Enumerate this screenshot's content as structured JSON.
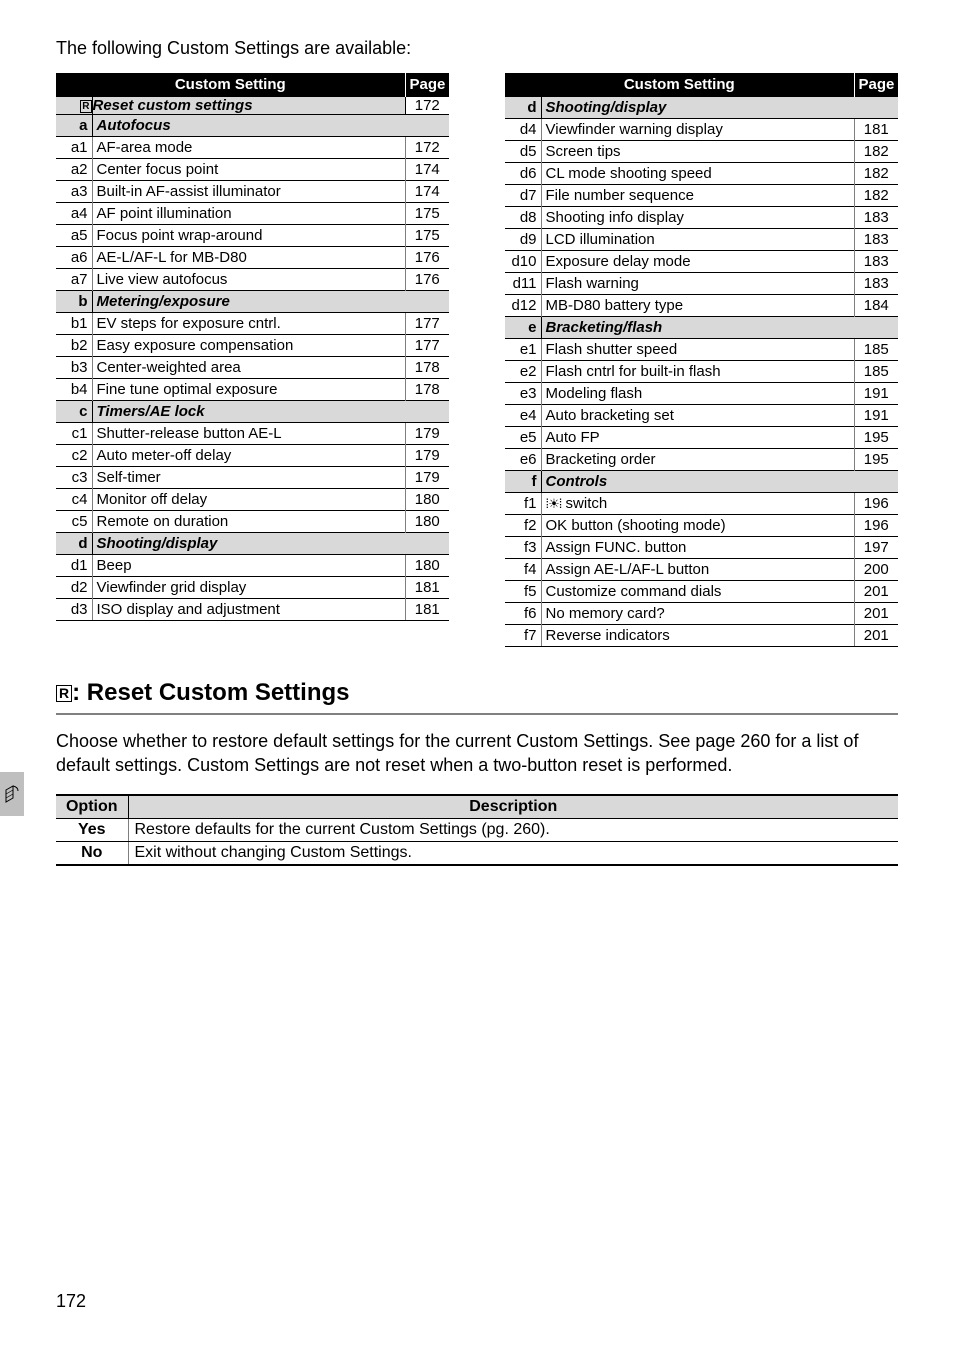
{
  "intro": "The following Custom Settings are available:",
  "table_header": {
    "setting": "Custom Setting",
    "page": "Page"
  },
  "reset_row": {
    "code": "R",
    "label": "Reset custom settings",
    "page": "172"
  },
  "col1": [
    {
      "group": true,
      "code": "a",
      "label": "Autofocus"
    },
    {
      "code": "a1",
      "label": "AF-area mode",
      "page": "172"
    },
    {
      "code": "a2",
      "label": "Center focus point",
      "page": "174"
    },
    {
      "code": "a3",
      "label": "Built-in AF-assist illuminator",
      "page": "174"
    },
    {
      "code": "a4",
      "label": "AF point illumination",
      "page": "175"
    },
    {
      "code": "a5",
      "label": "Focus point wrap-around",
      "page": "175"
    },
    {
      "code": "a6",
      "label": "AE-L/AF-L for MB-D80",
      "page": "176"
    },
    {
      "code": "a7",
      "label": "Live view autofocus",
      "page": "176"
    },
    {
      "group": true,
      "code": "b",
      "label": "Metering/exposure"
    },
    {
      "code": "b1",
      "label": "EV steps for exposure cntrl.",
      "page": "177"
    },
    {
      "code": "b2",
      "label": "Easy exposure compensation",
      "page": "177"
    },
    {
      "code": "b3",
      "label": "Center-weighted area",
      "page": "178"
    },
    {
      "code": "b4",
      "label": "Fine tune optimal exposure",
      "page": "178"
    },
    {
      "group": true,
      "code": "c",
      "label": "Timers/AE lock"
    },
    {
      "code": "c1",
      "label": "Shutter-release button AE-L",
      "page": "179"
    },
    {
      "code": "c2",
      "label": "Auto meter-off delay",
      "page": "179"
    },
    {
      "code": "c3",
      "label": "Self-timer",
      "page": "179"
    },
    {
      "code": "c4",
      "label": "Monitor off delay",
      "page": "180"
    },
    {
      "code": "c5",
      "label": "Remote on duration",
      "page": "180"
    },
    {
      "group": true,
      "code": "d",
      "label": "Shooting/display"
    },
    {
      "code": "d1",
      "label": "Beep",
      "page": "180"
    },
    {
      "code": "d2",
      "label": "Viewfinder grid display",
      "page": "181"
    },
    {
      "code": "d3",
      "label": "ISO display and adjustment",
      "page": "181"
    }
  ],
  "col2": [
    {
      "group": true,
      "code": "d",
      "label": "Shooting/display"
    },
    {
      "code": "d4",
      "label": "Viewfinder warning display",
      "page": "181"
    },
    {
      "code": "d5",
      "label": "Screen tips",
      "page": "182"
    },
    {
      "code": "d6",
      "label": "CL mode shooting speed",
      "page": "182"
    },
    {
      "code": "d7",
      "label": "File number sequence",
      "page": "182"
    },
    {
      "code": "d8",
      "label": "Shooting info display",
      "page": "183"
    },
    {
      "code": "d9",
      "label": "LCD illumination",
      "page": "183"
    },
    {
      "code": "d10",
      "label": "Exposure delay mode",
      "page": "183"
    },
    {
      "code": "d11",
      "label": "Flash warning",
      "page": "183"
    },
    {
      "code": "d12",
      "label": "MB-D80 battery type",
      "page": "184"
    },
    {
      "group": true,
      "code": "e",
      "label": "Bracketing/flash"
    },
    {
      "code": "e1",
      "label": "Flash shutter speed",
      "page": "185"
    },
    {
      "code": "e2",
      "label": "Flash cntrl for built-in flash",
      "page": "185"
    },
    {
      "code": "e3",
      "label": "Modeling flash",
      "page": "191"
    },
    {
      "code": "e4",
      "label": "Auto bracketing set",
      "page": "191"
    },
    {
      "code": "e5",
      "label": "Auto FP",
      "page": "195"
    },
    {
      "code": "e6",
      "label": "Bracketing order",
      "page": "195"
    },
    {
      "group": true,
      "code": "f",
      "label": "Controls"
    },
    {
      "code": "f1",
      "label": " switch",
      "switch_icon": true,
      "page": "196"
    },
    {
      "code": "f2",
      "label": "OK button (shooting mode)",
      "page": "196"
    },
    {
      "code": "f3",
      "label": "Assign FUNC.  button",
      "page": "197"
    },
    {
      "code": "f4",
      "label": "Assign AE-L/AF-L button",
      "page": "200"
    },
    {
      "code": "f5",
      "label": "Customize command dials",
      "page": "201"
    },
    {
      "code": "f6",
      "label": "No memory card?",
      "page": "201"
    },
    {
      "code": "f7",
      "label": "Reverse indicators",
      "page": "201"
    }
  ],
  "heading": ": Reset Custom Settings",
  "body": "Choose whether to restore default settings for the current Custom Settings.  See page 260 for a list of default settings.  Custom Settings are not reset when a two-button reset is performed.",
  "options_header": {
    "option": "Option",
    "description": "Description"
  },
  "options": [
    {
      "opt": "Yes",
      "desc": "Restore defaults for the current Custom Settings (pg. 260)."
    },
    {
      "opt": "No",
      "desc": "Exit without changing Custom Settings."
    }
  ],
  "page_number": "172"
}
